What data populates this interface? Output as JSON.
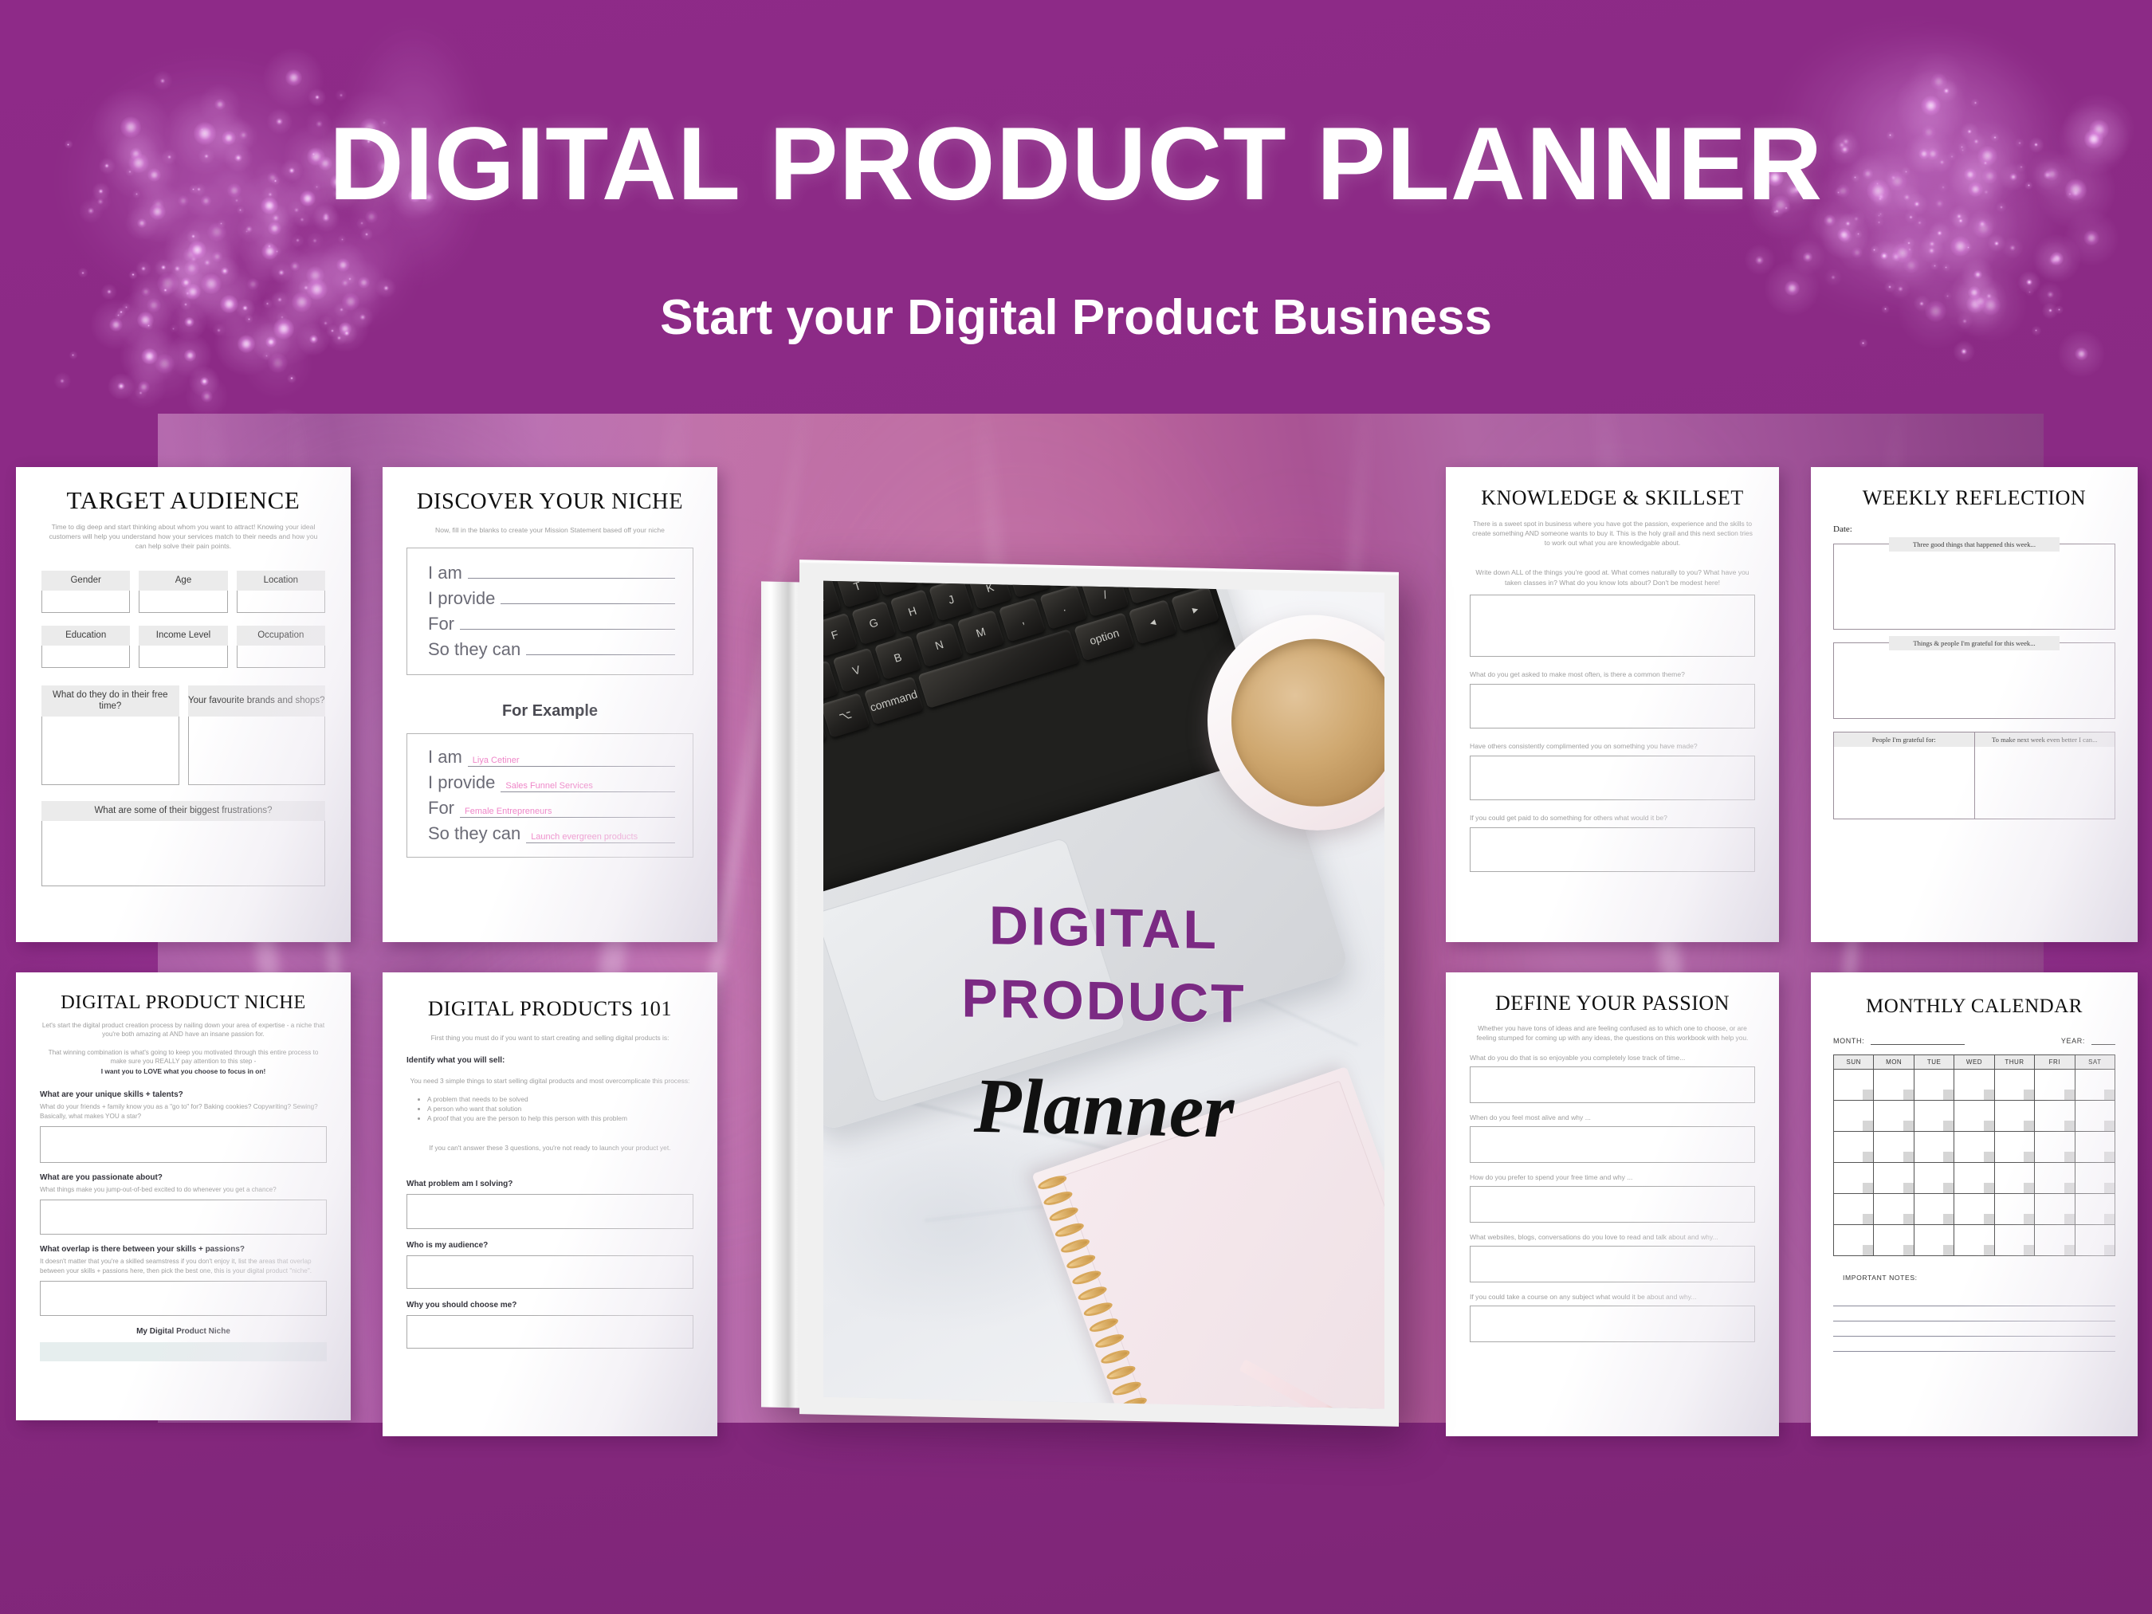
{
  "header": {
    "title": "DIGITAL PRODUCT PLANNER",
    "subtitle": "Start your Digital Product Business",
    "bg_color": "#8b2a85"
  },
  "book": {
    "cover_line1": "DIGITAL",
    "cover_line2": "PRODUCT",
    "cover_script": "Planner"
  },
  "pages": {
    "target_audience": {
      "title": "TARGET AUDIENCE",
      "desc": "Time to dig deep and start thinking about whom you want to attract! Knowing your ideal customers will help you understand how your services match to their needs and how you can help solve their pain points.",
      "fields_row1": [
        "Gender",
        "Age",
        "Location"
      ],
      "fields_row2": [
        "Education",
        "Income Level",
        "Occupation"
      ],
      "big_left": "What do they do in their free time?",
      "big_right": "Your favourite brands and shops?",
      "wide": "What are some of their biggest frustrations?"
    },
    "discover_niche": {
      "title": "DISCOVER YOUR NICHE",
      "desc": "Now, fill in the blanks to create your Mission Statement based off your niche",
      "lines": [
        "I am",
        "I provide",
        "For",
        "So they can"
      ],
      "example_heading": "For Example",
      "example_values": [
        "Liya Cetiner",
        "Sales Funnel Services",
        "Female Entrepreneurs",
        "Launch evergreen products"
      ],
      "example_color": "#ef86c8"
    },
    "knowledge_skillset": {
      "title": "KNOWLEDGE & SKILLSET",
      "desc": "There is a sweet spot in business where you have got the passion, experience and the skills to create something AND someone wants to buy it. This is the holy grail and this next section tries to work out what you are knowledgable about.",
      "questions": [
        "Write down ALL of the things you're good at. What comes naturally to you? What have you taken classes in? What do you know lots about? Don't be modest here!",
        "What do you get asked to make most often, is there a common theme?",
        "Have others consistently complimented you on something you have made?",
        "If you could get paid to do something for others what would it be?"
      ]
    },
    "weekly_reflection": {
      "title": "WEEKLY REFLECTION",
      "date_label": "Date:",
      "tab1": "Three good things that happened this week...",
      "tab2": "Things & people I'm grateful for this week...",
      "col1": "People I'm grateful for:",
      "col2": "To make next week even better I can..."
    },
    "digital_product_niche": {
      "title": "DIGITAL PRODUCT NICHE",
      "desc1": "Let's start the digital product creation process by nailing down your area of expertise - a niche that you're both amazing at AND have an insane passion for.",
      "desc2": "That winning combination is what's going to keep you motivated through this entire process to make sure you REALLY pay attention to this step -",
      "desc2_bold": "I want you to LOVE what you choose to focus in on!",
      "q1": "What are your unique skills + talents?",
      "q1_sub": "What do your friends + family know you as a \"go to\" for? Baking cookies? Copywriting? Sewing? Basically, what makes YOU a star?",
      "q2": "What are you passionate about?",
      "q2_sub": "What things make you jump-out-of-bed excited to do whenever you get a chance?",
      "q3": "What overlap is there between your skills + passions?",
      "q3_sub": "It doesn't matter that you're a skilled seamstress if you don't enjoy it, list the areas that overlap between your skills + passions here, then pick the best one, this is your digital product \"niche\".",
      "final_label": "My Digital Product Niche",
      "final_fill_color": "#e6eeee"
    },
    "digital_products_101": {
      "title": "DIGITAL PRODUCTS 101",
      "desc": "First thing you must do if you want to start creating and selling digital products is:",
      "subhead": "Identify what you will sell:",
      "desc2": "You need 3 simple things to start selling digital products and most overcomplicate this process:",
      "bullets": [
        "A problem that needs to be solved",
        "A person who want that solution",
        "A proof that you are the person to help this person with this problem"
      ],
      "warning": "If you can't answer these 3 questions, you're not ready to launch your product yet.",
      "questions": [
        "What problem am I solving?",
        "Who is my audience?",
        "Why you should choose me?"
      ]
    },
    "define_passion": {
      "title": "DEFINE YOUR PASSION",
      "desc": "Whether you have tons of ideas and are feeling confused as to which one to choose, or are feeling stumped for coming up with any ideas, the questions on this workbook with help you.",
      "questions": [
        "What do you do that is so enjoyable you completely lose track of time...",
        "When do you feel most alive and why ...",
        "How do you prefer to spend your free time and why ...",
        "What websites, blogs, conversations do you love to read and talk about and why...",
        "If you could take a course on any subject what would it be about and why..."
      ]
    },
    "monthly_calendar": {
      "title": "MONTHLY CALENDAR",
      "month_label": "MONTH:",
      "year_label": "YEAR:",
      "days": [
        "SUN",
        "MON",
        "TUE",
        "WED",
        "THUR",
        "FRI",
        "SAT"
      ],
      "weeks": 6,
      "notes_label": "IMPORTANT NOTES:",
      "note_lines": 4
    }
  }
}
